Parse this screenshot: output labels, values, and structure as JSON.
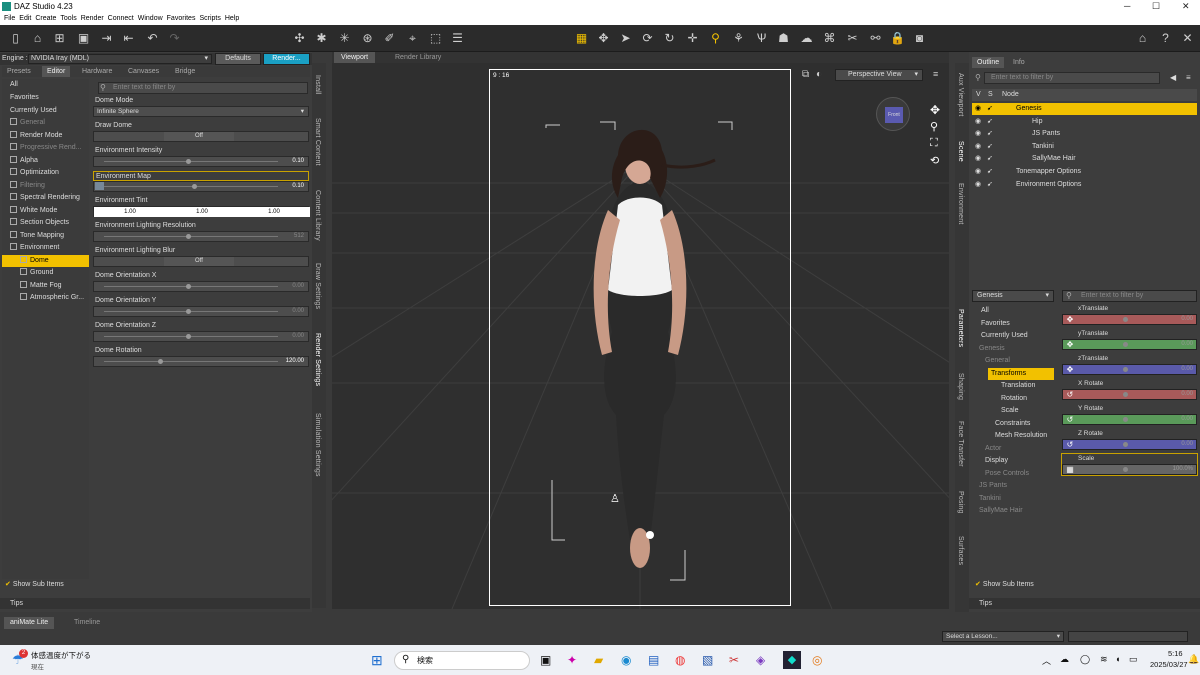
{
  "app": {
    "title": "DAZ Studio 4.23"
  },
  "menu": [
    "File",
    "Edit",
    "Create",
    "Tools",
    "Render",
    "Connect",
    "Window",
    "Favorites",
    "Scripts",
    "Help"
  ],
  "render_settings": {
    "engine_label": "Engine :",
    "engine_value": "NVIDIA Iray (MDL)",
    "defaults_label": "Defaults",
    "render_label": "Render...",
    "tabs": [
      "Presets",
      "Editor",
      "Hardware",
      "Canvases",
      "Bridge"
    ],
    "filter_placeholder": "Enter text to filter by",
    "categories": [
      {
        "label": "All"
      },
      {
        "label": "Favorites"
      },
      {
        "label": "Currently Used"
      },
      {
        "label": "General",
        "dim": true
      },
      {
        "label": "Render Mode"
      },
      {
        "label": "Progressive Rend...",
        "dim": true
      },
      {
        "label": "Alpha"
      },
      {
        "label": "Optimization"
      },
      {
        "label": "Filtering",
        "dim": true
      },
      {
        "label": "Spectral Rendering"
      },
      {
        "label": "White Mode"
      },
      {
        "label": "Section Objects"
      },
      {
        "label": "Tone Mapping"
      },
      {
        "label": "Environment"
      },
      {
        "label": "Dome",
        "selected": true
      },
      {
        "label": "Ground"
      },
      {
        "label": "Matte Fog"
      },
      {
        "label": "Atmospheric Gr..."
      }
    ],
    "properties": {
      "dome_mode": {
        "label": "Dome Mode",
        "value": "Infinite Sphere"
      },
      "draw_dome": {
        "label": "Draw Dome",
        "value": "Off"
      },
      "env_intensity": {
        "label": "Environment Intensity",
        "value": "0.10",
        "level": 0.1
      },
      "env_map": {
        "label": "Environment Map",
        "value": "0.10",
        "level": 0.1
      },
      "env_tint": {
        "label": "Environment Tint",
        "values": [
          "1.00",
          "1.00",
          "1.00"
        ]
      },
      "env_light_res": {
        "label": "Environment Lighting Resolution",
        "value": "512"
      },
      "env_light_blur": {
        "label": "Environment Lighting Blur",
        "value": "Off"
      },
      "dome_orient_x": {
        "label": "Dome Orientation X",
        "value": "0.00"
      },
      "dome_orient_y": {
        "label": "Dome Orientation Y",
        "value": "0.00"
      },
      "dome_orient_z": {
        "label": "Dome Orientation Z",
        "value": "0.00"
      },
      "dome_rotation": {
        "label": "Dome Rotation",
        "value": "120.00"
      }
    },
    "show_sub_items": "Show Sub Items",
    "tips": "Tips"
  },
  "left_vtabs": [
    "Install",
    "Smart Content",
    "Content Library",
    "Draw Settings",
    "Render Settings",
    "Simulation Settings"
  ],
  "viewport": {
    "tabs": [
      "Viewport",
      "Render Library"
    ],
    "aspect": "9 : 16",
    "view_select": "Perspective View",
    "cube_label": "Front"
  },
  "scene": {
    "tabs": [
      "Outline",
      "Info"
    ],
    "filter_placeholder": "Enter text to filter by",
    "col_v": "V",
    "col_s": "S",
    "col_node": "Node",
    "nodes": [
      {
        "label": "Genesis",
        "selected": true
      },
      {
        "label": "Hip"
      },
      {
        "label": "JS Pants"
      },
      {
        "label": "Tankini"
      },
      {
        "label": "SallyMae Hair"
      },
      {
        "label": "Tonemapper Options"
      },
      {
        "label": "Environment Options"
      }
    ]
  },
  "right_vtabs_top": [
    "Aux Viewport",
    "Scene",
    "Environment"
  ],
  "right_vtabs_bottom": [
    "Parameters",
    "Shaping",
    "Face Transfer",
    "Posing",
    "Surfaces"
  ],
  "parameters": {
    "node_select": "Genesis",
    "filter_placeholder": "Enter text to filter by",
    "tree": [
      {
        "label": "All"
      },
      {
        "label": "Favorites"
      },
      {
        "label": "Currently Used"
      },
      {
        "label": "Genesis",
        "dim": true
      },
      {
        "label": "General",
        "dim": true
      },
      {
        "label": "Transforms",
        "selected": true
      },
      {
        "label": "Translation"
      },
      {
        "label": "Rotation"
      },
      {
        "label": "Scale"
      },
      {
        "label": "Constraints"
      },
      {
        "label": "Mesh Resolution"
      },
      {
        "label": "Actor",
        "dim": true
      },
      {
        "label": "Display"
      },
      {
        "label": "Pose Controls",
        "dim": true
      },
      {
        "label": "JS Pants",
        "dim": true
      },
      {
        "label": "Tankini",
        "dim": true
      },
      {
        "label": "SallyMae Hair",
        "dim": true
      }
    ],
    "items": [
      {
        "label": "xTranslate",
        "value": "0.00",
        "color": "#a85a5a"
      },
      {
        "label": "yTranslate",
        "value": "0.00",
        "color": "#5a9a5a"
      },
      {
        "label": "zTranslate",
        "value": "0.00",
        "color": "#5a5aaa"
      },
      {
        "label": "X Rotate",
        "value": "0.00",
        "color": "#a85a5a"
      },
      {
        "label": "Y Rotate",
        "value": "0.00",
        "color": "#5a9a5a"
      },
      {
        "label": "Z Rotate",
        "value": "0.00",
        "color": "#5a5aaa"
      },
      {
        "label": "Scale",
        "value": "100.0%",
        "color": "#666666"
      }
    ],
    "show_sub_items": "Show Sub Items",
    "tips": "Tips"
  },
  "bottom": {
    "tabs": [
      "aniMate Lite",
      "Timeline"
    ],
    "lesson_select": "Select a Lesson..."
  },
  "taskbar": {
    "weather_badge": "2",
    "weather_text": "体感温度が下がる",
    "weather_sub": "現在",
    "search_label": "検索",
    "time": "5:16",
    "date": "2025/03/27"
  },
  "colors": {
    "accent": "#f2c100",
    "render_btn": "#1aa0c4"
  }
}
